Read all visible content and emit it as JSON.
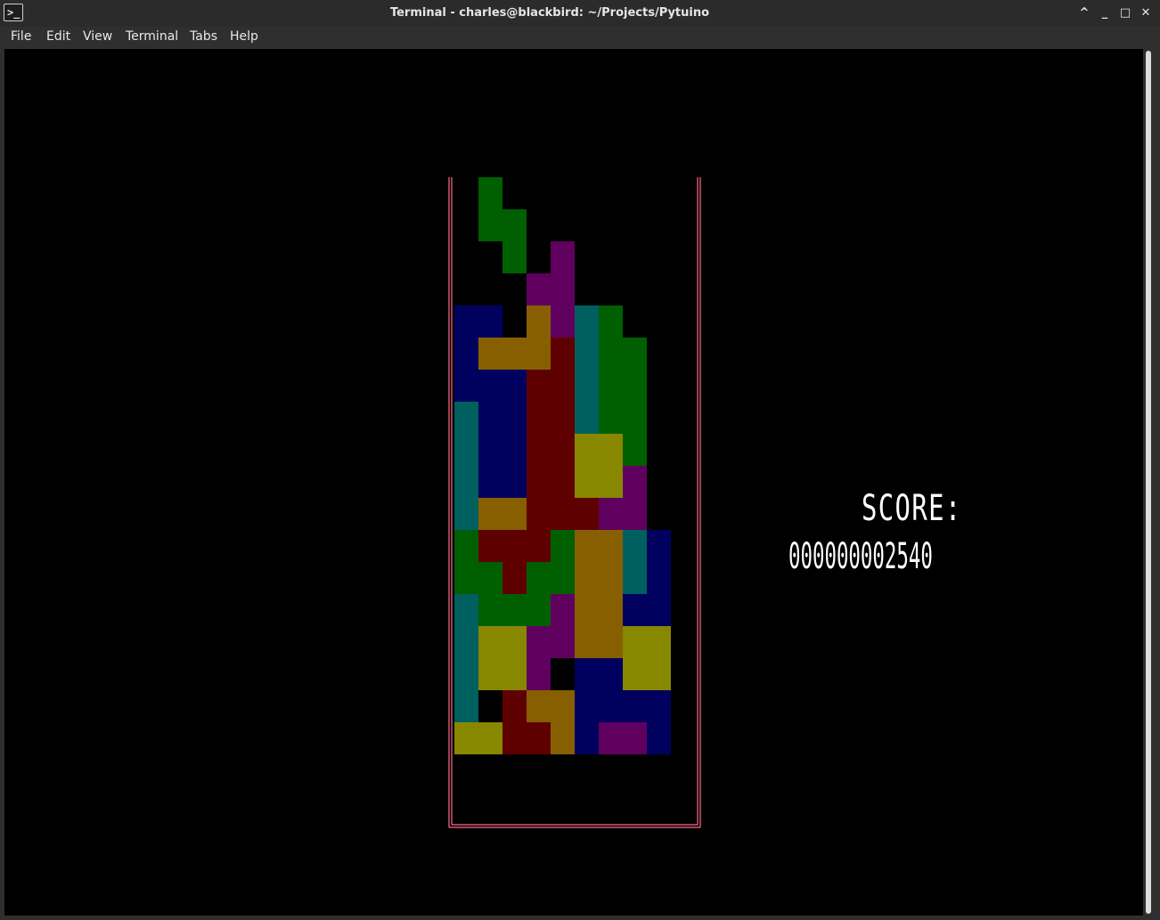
{
  "window": {
    "title": "Terminal - charles@blackbird: ~/Projects/Pytuino",
    "icon": "terminal-icon",
    "controls": [
      "chevron-up-icon",
      "minimize-icon",
      "maximize-icon",
      "close-icon"
    ],
    "control_glyphs": {
      "up": "^",
      "min": "_",
      "max": "□",
      "close": "✕"
    }
  },
  "menubar": {
    "items": [
      "File",
      "Edit",
      "View",
      "Terminal",
      "Tabs",
      "Help"
    ]
  },
  "game": {
    "score_label": "SCORE:",
    "score_value": "000000002540",
    "board_cols": 9,
    "board_rows": 18,
    "border_color": "#ff6b8a",
    "colors": {
      "G": "#005f00",
      "M": "#5f005f",
      "B": "#00005f",
      "O": "#875f00",
      "R": "#5f0000",
      "T": "#005f5f",
      "Y": "#878700"
    },
    "grid": [
      ".........",
      ".........",
      ".G.......",
      ".GG......",
      "..G.M....",
      "...MM....",
      "BB.OMTG..",
      "BOOORTGG.",
      "BBBRRTGG.",
      "TBBRRTGG.",
      "TBBRRYYG.",
      "TBBRRYYM.",
      "TOORRRMM.",
      "GRRRGOOTB",
      "GGRGGOOTB",
      "TGGGMOOBB",
      "TYYMMOOYY",
      "TYYM.BBYY",
      "T.ROOBBBB",
      "YYRROBMMB"
    ]
  }
}
